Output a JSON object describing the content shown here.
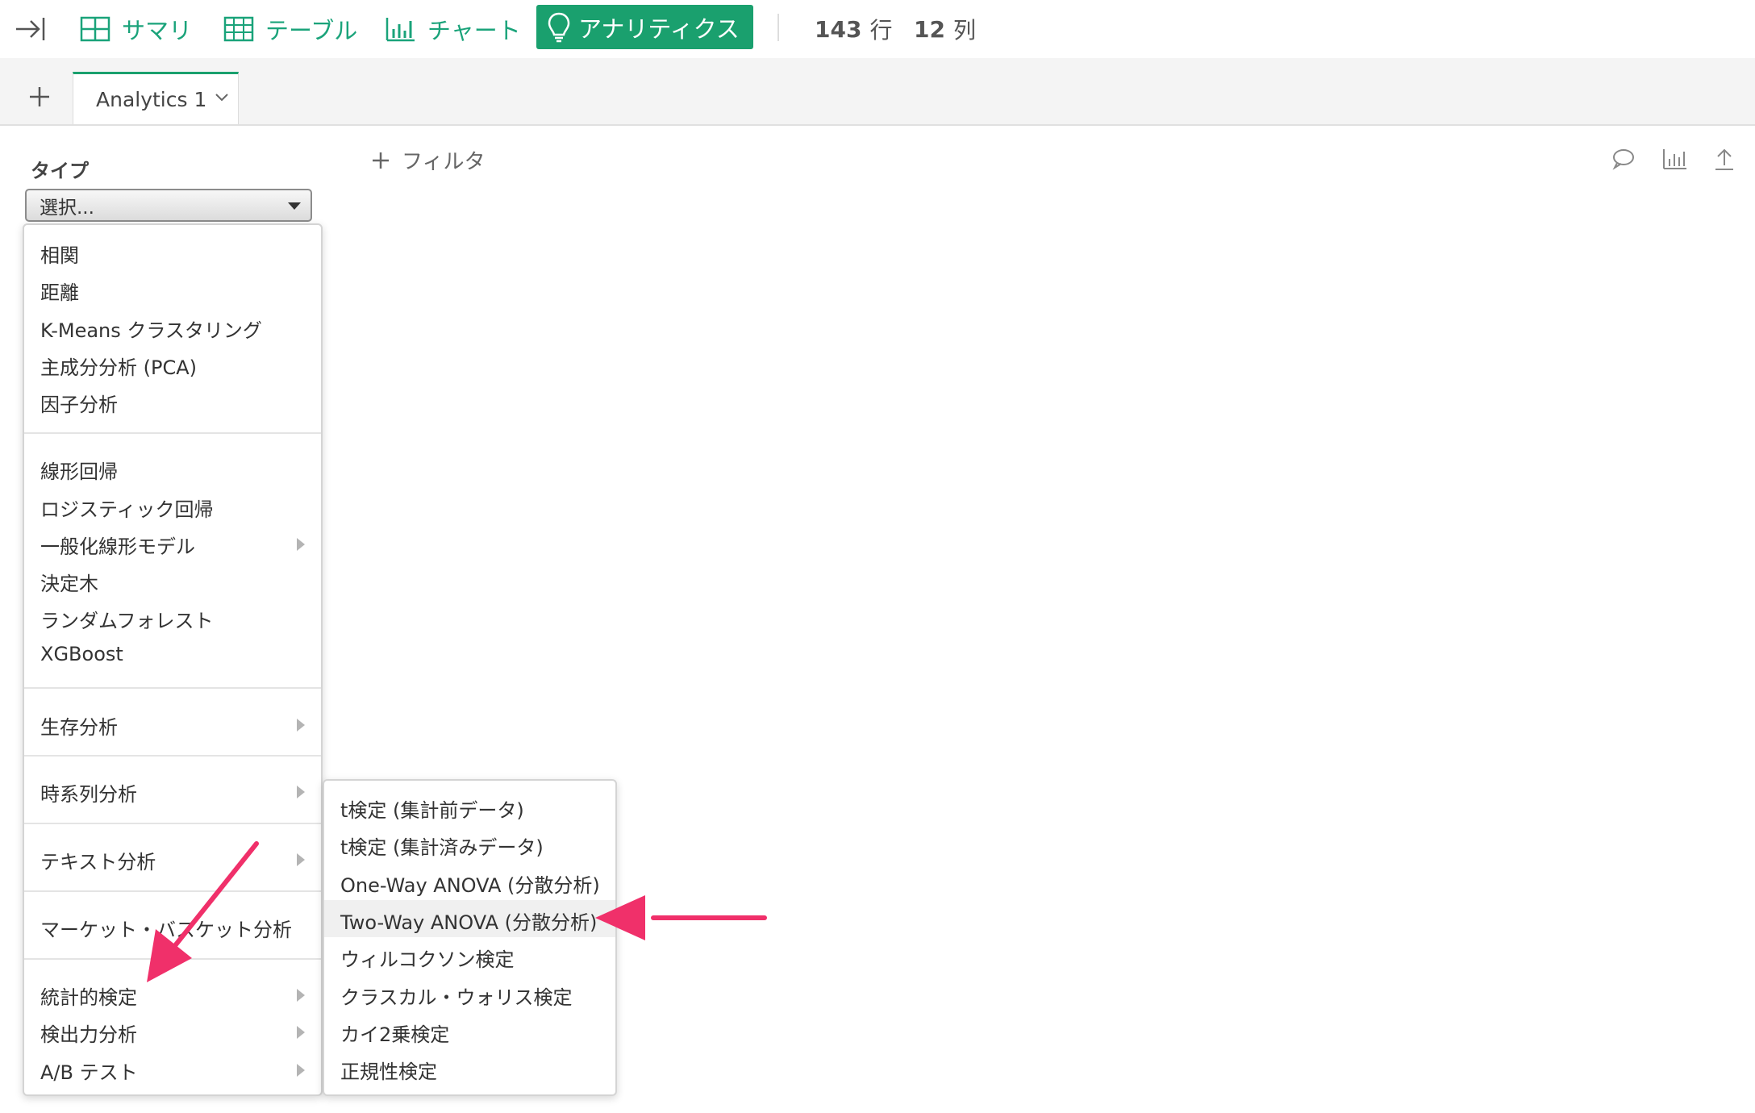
{
  "toolbar": {
    "tabs": [
      {
        "label": "サマリ",
        "icon": "summary-grid-icon"
      },
      {
        "label": "テーブル",
        "icon": "table-icon"
      },
      {
        "label": "チャート",
        "icon": "bar-chart-icon"
      },
      {
        "label": "アナリティクス",
        "icon": "lightbulb-icon",
        "active": true
      }
    ],
    "rows_value": "143",
    "rows_label": "行",
    "cols_value": "12",
    "cols_label": "列",
    "accent_color": "#1aa06e"
  },
  "tabbar": {
    "tab_label": "Analytics 1"
  },
  "main": {
    "type_label": "タイプ",
    "select_value": "選択...",
    "filter_label": "フィルタ"
  },
  "menu": {
    "items": [
      {
        "label": "相関",
        "submenu": false
      },
      {
        "label": "距離",
        "submenu": false
      },
      {
        "label": "K-Means クラスタリング",
        "submenu": false
      },
      {
        "label": "主成分分析 (PCA)",
        "submenu": false
      },
      {
        "label": "因子分析",
        "submenu": false
      },
      {
        "label": "線形回帰",
        "submenu": false
      },
      {
        "label": "ロジスティック回帰",
        "submenu": false
      },
      {
        "label": "一般化線形モデル",
        "submenu": true
      },
      {
        "label": "決定木",
        "submenu": false
      },
      {
        "label": "ランダムフォレスト",
        "submenu": false
      },
      {
        "label": "XGBoost",
        "submenu": false
      },
      {
        "label": "生存分析",
        "submenu": true
      },
      {
        "label": "時系列分析",
        "submenu": true
      },
      {
        "label": "テキスト分析",
        "submenu": true
      },
      {
        "label": "マーケット・バスケット分析",
        "submenu": false
      },
      {
        "label": "統計的検定",
        "submenu": true
      },
      {
        "label": "検出力分析",
        "submenu": true
      },
      {
        "label": "A/B テスト",
        "submenu": true
      }
    ]
  },
  "submenu": {
    "items": [
      "t検定 (集計前データ)",
      "t検定 (集計済みデータ)",
      "One-Way ANOVA (分散分析)",
      "Two-Way ANOVA (分散分析)",
      "ウィルコクソン検定",
      "クラスカル・ウォリス検定",
      "カイ2乗検定",
      "正規性検定"
    ],
    "highlighted_index": 3
  },
  "annotation_color": "#f0306a"
}
